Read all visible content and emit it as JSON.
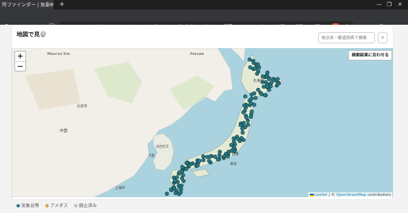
{
  "browser": {
    "tab_title": "所ファインダー | 気象データダウ",
    "tab_close": "×",
    "new_tab": "+",
    "window_controls": [
      "—",
      "❐",
      "✕"
    ],
    "url": "awg-yk.github.io/weather-station-finder/?pref=宗谷%2C上川%2C留萌%2Cオホーツク%2C十勝%2C釧路%2C根室%2C石狩%2C空知%2C後志%"
  },
  "page": {
    "title": "地図で見る",
    "info": "i",
    "search_placeholder": "地点名・都道府県で検索",
    "clear": "×",
    "fit_button": "検索結果に合わせる",
    "zoom_in": "+",
    "zoom_out": "−"
  },
  "attribution": {
    "leaflet": "Leaflet",
    "sep": " | © ",
    "osm": "OpenStreetMap",
    "tail": " contributors"
  },
  "map_labels": {
    "mongolia": "Монгол Улс",
    "china": "中国",
    "korea": "대한민국",
    "japan": "日本",
    "russia": "Россия",
    "beijing": "北京市",
    "seoul": "서울",
    "tokyo": "東京",
    "sapporo": "札幌市",
    "shanghai": "上海市"
  },
  "legend": [
    {
      "label": "気象台等",
      "color": "#2a7a86"
    },
    {
      "label": "アメダス",
      "color": "#d9a24a"
    },
    {
      "label": "廃止済み",
      "color": "#bdbdbd"
    }
  ],
  "colors": {
    "station": "#2a7a86",
    "station_stroke": "#0e3d44",
    "land": "#f2efe9",
    "sea": "#aad3df"
  }
}
